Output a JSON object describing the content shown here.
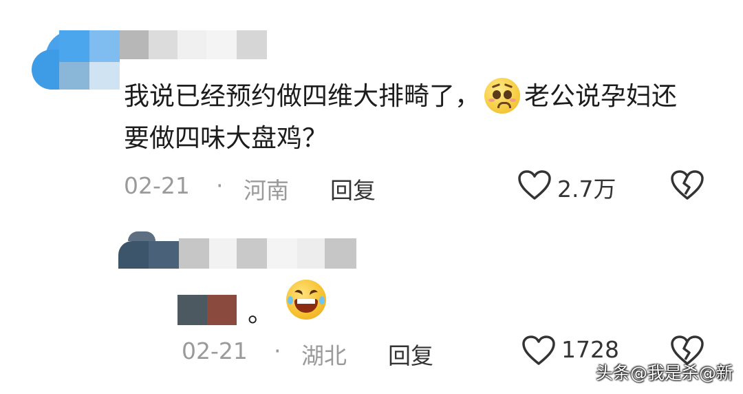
{
  "comment1": {
    "text_part1": "我说已经预约做四维大排畸了，",
    "emoji": "worried-face-icon",
    "text_part2": "老公说孕妇还要做四味大盘鸡？",
    "date": "02-21",
    "separator": "·",
    "location": "河南",
    "reply_label": "回复",
    "like_count": "2.7万"
  },
  "comment2": {
    "text": "。",
    "emoji": "laughing-face-icon",
    "date": "02-21",
    "separator": "·",
    "location": "湖北",
    "reply_label": "回复",
    "like_count": "1728"
  },
  "watermark": "头条@我是杀@新"
}
